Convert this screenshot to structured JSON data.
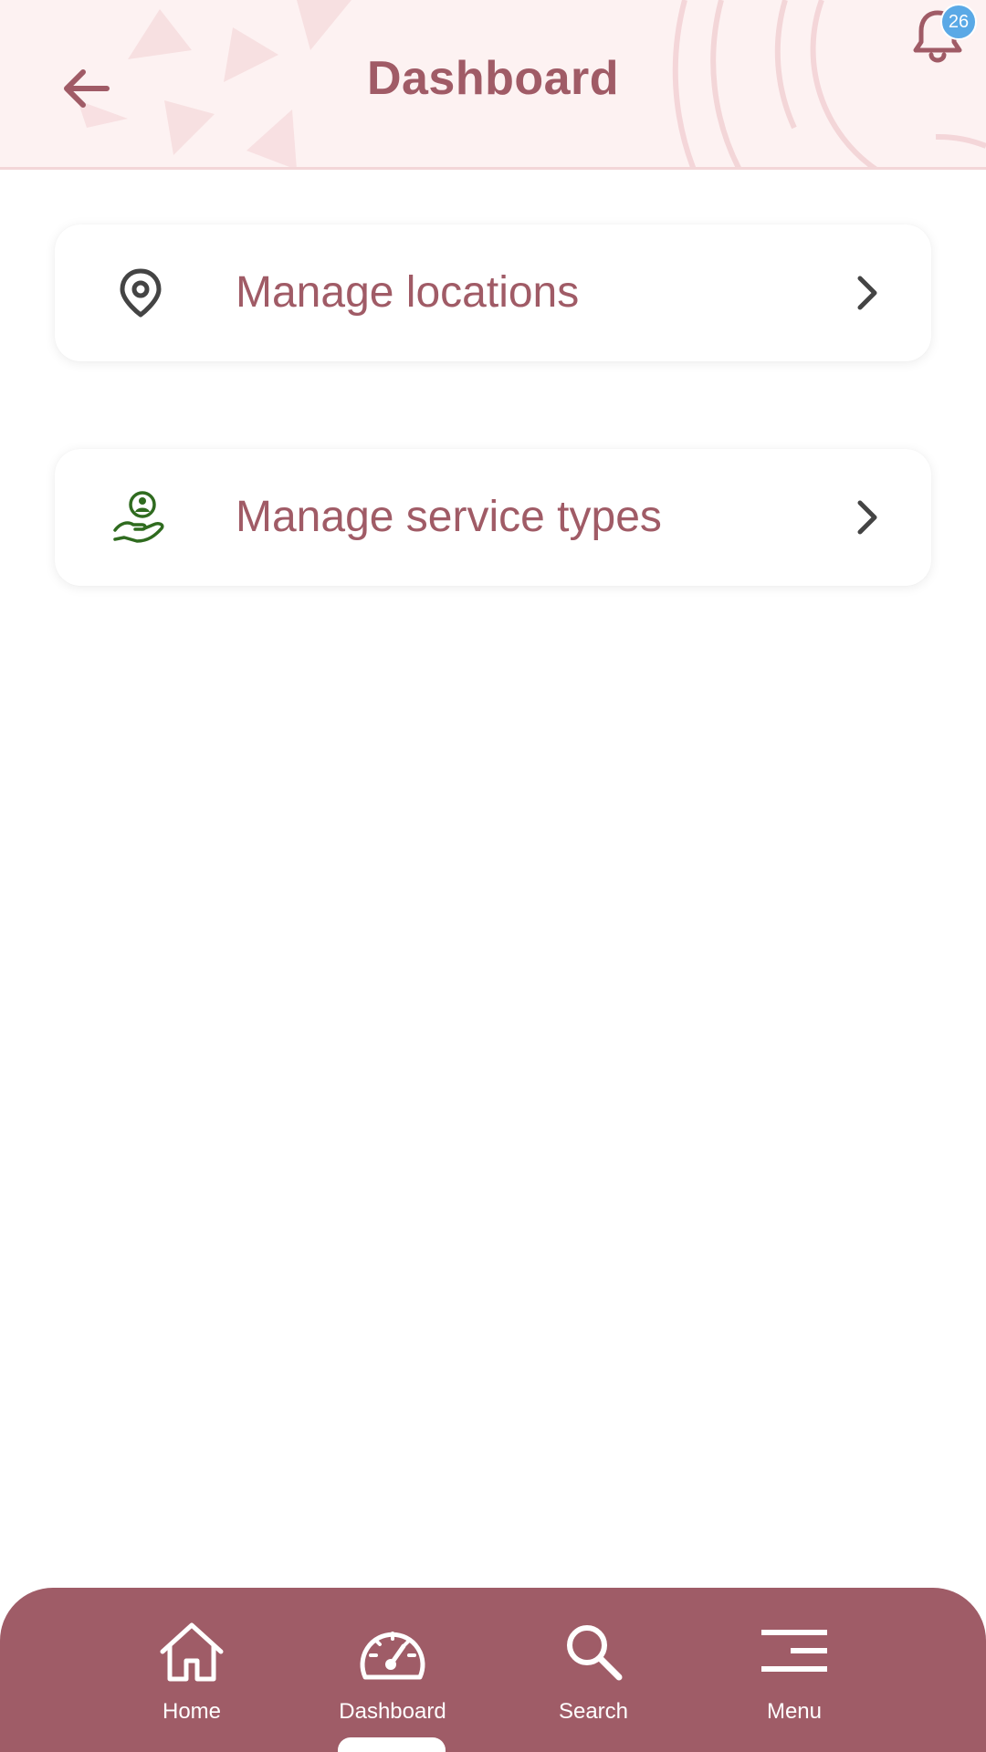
{
  "header": {
    "title": "Dashboard",
    "notifications_count": "26"
  },
  "cards": [
    {
      "label": "Manage locations",
      "icon": "location-pin-icon"
    },
    {
      "label": "Manage service types",
      "icon": "hand-user-icon"
    }
  ],
  "bottom_nav": {
    "items": [
      {
        "label": "Home",
        "icon": "home-icon"
      },
      {
        "label": "Dashboard",
        "icon": "speedometer-icon"
      },
      {
        "label": "Search",
        "icon": "search-icon"
      },
      {
        "label": "Menu",
        "icon": "menu-icon"
      }
    ],
    "active": "Dashboard"
  },
  "colors": {
    "brand": "#9f5c67",
    "title": "#a05b66",
    "header_bg": "#fdf2f2",
    "badge": "#5aa9e6",
    "service_icon": "#2f6b1f"
  }
}
